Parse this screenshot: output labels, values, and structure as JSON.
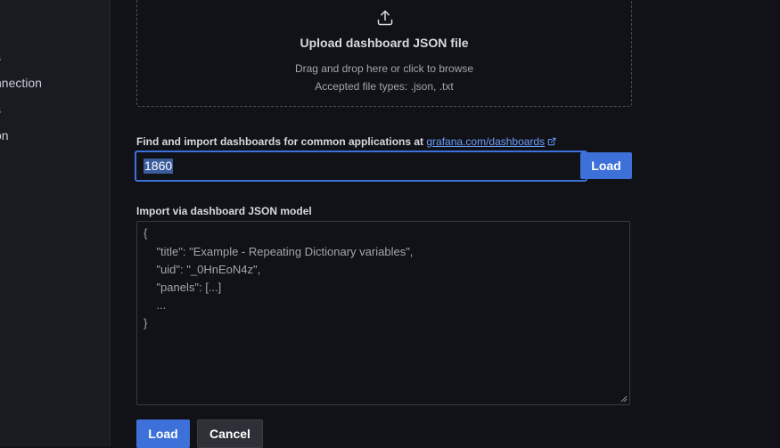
{
  "sidebar": {
    "items": [
      {
        "label": "s"
      },
      {
        "label": "nnection"
      },
      {
        "label": "s"
      },
      {
        "label": "on"
      }
    ]
  },
  "upload": {
    "title": "Upload dashboard JSON file",
    "hint": "Drag and drop here or click to browse",
    "accepted": "Accepted file types: .json, .txt",
    "icon": "upload-icon"
  },
  "find": {
    "label": "Find and import dashboards for common applications at ",
    "link_text": "grafana.com/dashboards",
    "link_icon": "external-link-icon",
    "input_value": "1860",
    "load_label": "Load"
  },
  "json_model": {
    "label": "Import via dashboard JSON model",
    "lines": [
      "{",
      "    \"title\": \"Example - Repeating Dictionary variables\",",
      "    \"uid\": \"_0HnEoN4z\",",
      "    \"panels\": [...]",
      "    ...",
      "}"
    ]
  },
  "actions": {
    "load_label": "Load",
    "cancel_label": "Cancel"
  },
  "colors": {
    "background": "#111217",
    "sidebar": "#181b1f",
    "primary": "#3d71d9",
    "link": "#6e9fff"
  }
}
